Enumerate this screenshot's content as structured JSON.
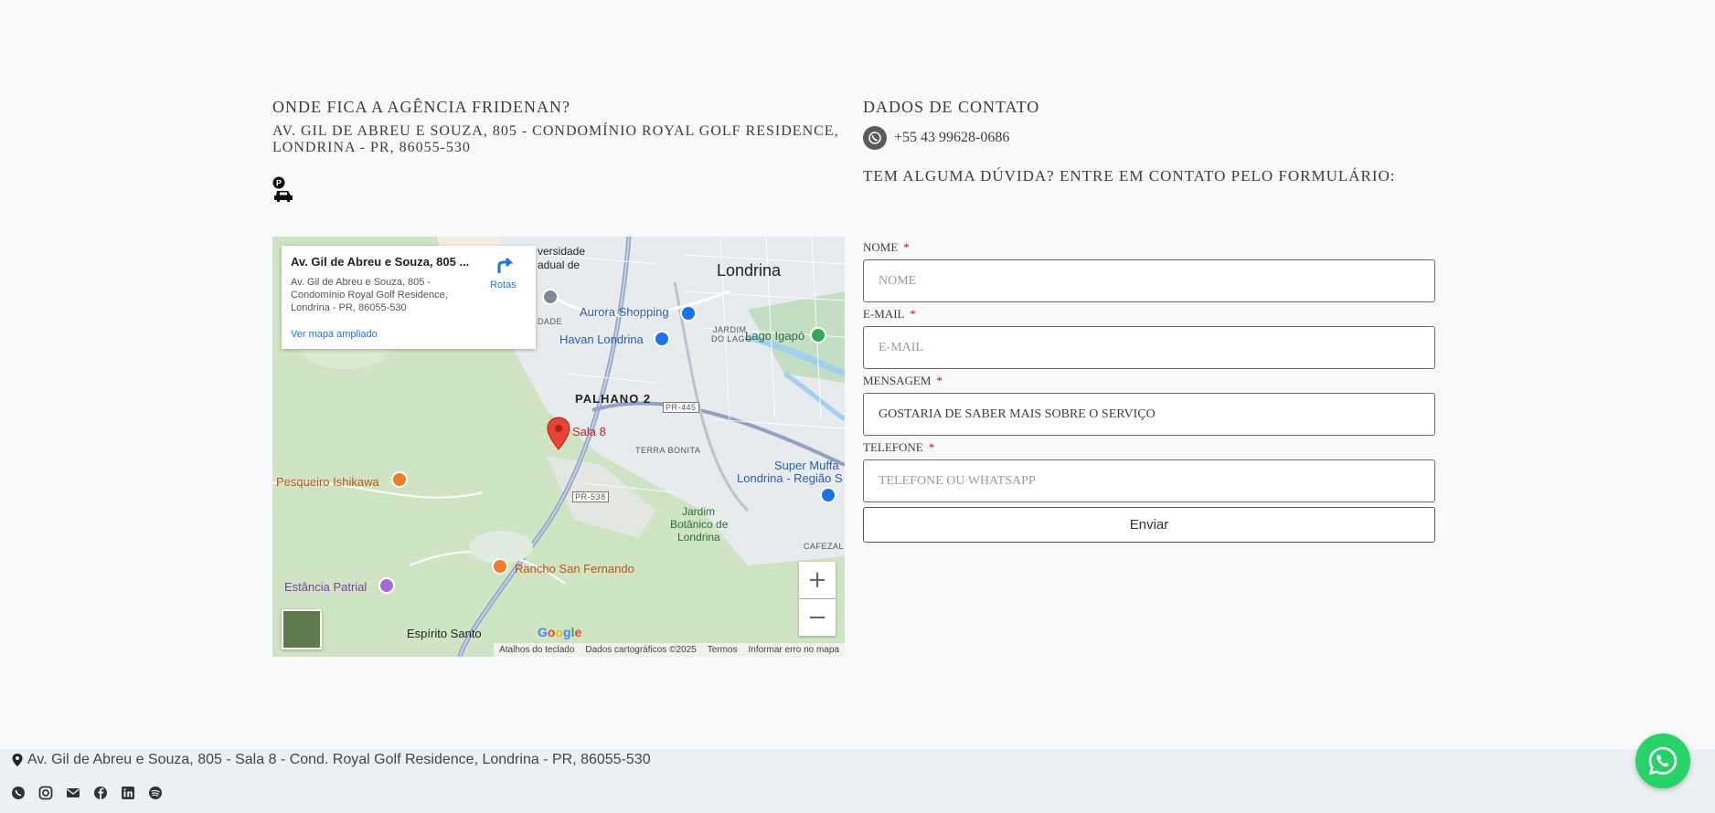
{
  "location": {
    "heading": "Onde fica a agência Fridenan?",
    "address": "Av. Gil de Abreu e Souza, 805 - Condomínio Royal Golf Residence, Londrina - PR, 86055-530",
    "parking_icon": "parking-car-icon"
  },
  "map": {
    "card": {
      "title": "Av. Gil de Abreu e Souza, 805 ...",
      "address": "Av. Gil de Abreu e Souza, 805 - Condomínio Royal Golf Residence, Londrina - PR, 86055-530",
      "enlarge_link": "Ver mapa ampliado",
      "directions_label": "Rotas"
    },
    "pin_label": "Sala 8",
    "labels": {
      "londrina": "Londrina",
      "universidade_1": "versidade",
      "universidade_2": "adual de",
      "universidade_3": "DADE",
      "aurora": "Aurora Shopping",
      "havan": "Havan Londrina",
      "jardim_lago_1": "JARDIM",
      "jardim_lago_2": "DO LAGO",
      "lago_igapo": "Lago Igapó",
      "palhano": "PALHANO 2",
      "pr445": "PR-445",
      "terra_bonita": "TERRA BONITA",
      "super_muffato_1": "Super Muffa",
      "super_muffato_2": "Londrina - Região S",
      "pesqueiro": "Pesqueiro Ishikawa",
      "pr538": "PR-538",
      "jardim_botanico_1": "Jardim",
      "jardim_botanico_2": "Botânico de",
      "jardim_botanico_3": "Londrina",
      "cafezal": "CAFEZAL",
      "rancho": "Rancho San Fernando",
      "estancia": "Estância Patrial",
      "espirito_santo": "Espírito Santo"
    },
    "zoom_in": "+",
    "zoom_out": "−",
    "logo": "Google",
    "attribution": {
      "shortcuts": "Atalhos do teclado",
      "data": "Dados cartográficos ©2025",
      "terms": "Termos",
      "report": "Informar erro no mapa"
    }
  },
  "contact": {
    "heading": "Dados de contato",
    "phone": "+55 43 99628-0686",
    "phone_icon": "whatsapp-icon",
    "form_question": "Tem alguma dúvida? Entre em contato pelo formulário:"
  },
  "form": {
    "name_label": "Nome",
    "name_placeholder": "Nome",
    "email_label": "E-mail",
    "email_placeholder": "E-mail",
    "message_label": "Mensagem",
    "message_value": "Gostaria de saber mais sobre o serviço",
    "phone_label": "Telefone",
    "phone_placeholder": "Telefone ou Whatsapp",
    "required_marker": "*",
    "submit": "Enviar"
  },
  "footer": {
    "address": "Av. Gil de Abreu e Souza, 805 - Sala 8 - Cond. Royal Golf Residence, Londrina - PR, 86055-530",
    "social_icons": [
      "whatsapp-icon",
      "instagram-icon",
      "email-icon",
      "facebook-icon",
      "linkedin-icon",
      "spotify-icon"
    ]
  },
  "colors": {
    "whatsapp_green": "#25d366",
    "link_blue": "#1a73e8",
    "pin_red": "#c5221f",
    "required_red": "#dd0000"
  }
}
